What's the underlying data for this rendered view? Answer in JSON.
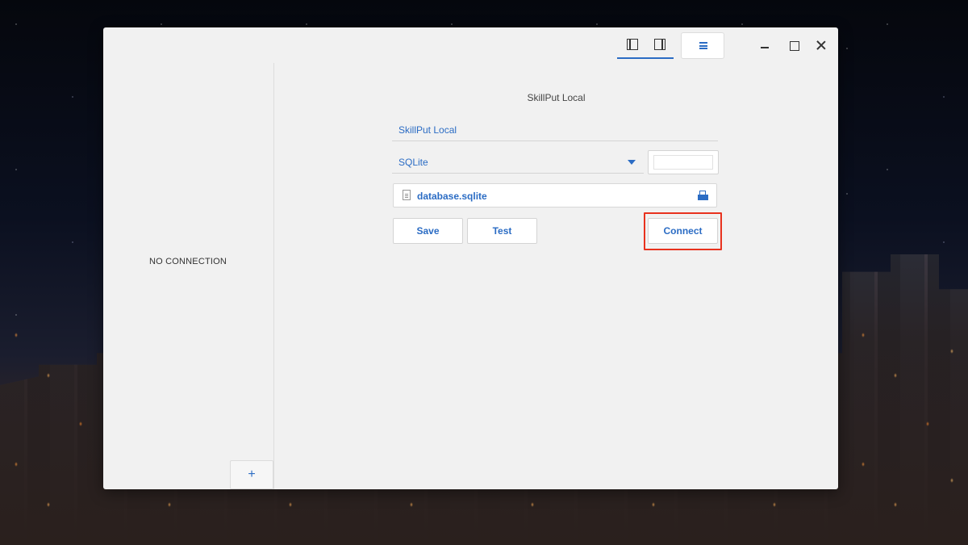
{
  "window": {
    "toolbar": {
      "toggle_left_panel": "toggle-left-panel",
      "toggle_right_panel": "toggle-right-panel",
      "menu": "hamburger-menu"
    },
    "controls": [
      "minimize",
      "maximize",
      "close"
    ]
  },
  "sidebar": {
    "empty_label": "NO CONNECTION",
    "add_label": "+"
  },
  "form": {
    "title": "SkillPut Local",
    "name_value": "SkillPut Local",
    "driver_value": "SQLite",
    "file_value": "database.sqlite",
    "buttons": {
      "save": "Save",
      "test": "Test",
      "connect": "Connect"
    }
  },
  "colors": {
    "accent": "#2b6cc4",
    "highlight": "#e8321e",
    "window_bg": "#f1f1f1"
  }
}
